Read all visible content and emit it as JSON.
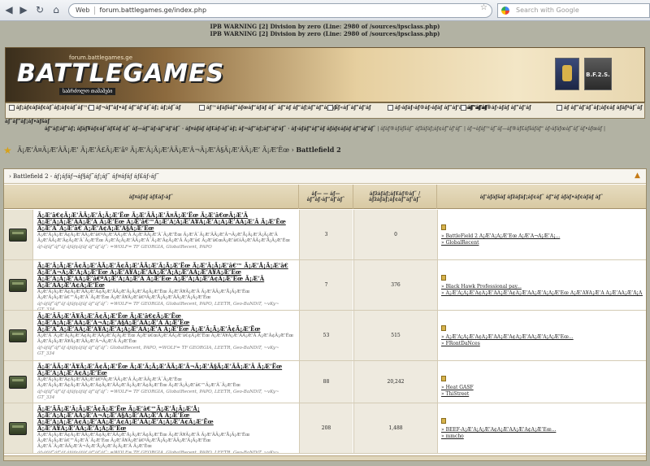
{
  "browser": {
    "address_prefix": "Web",
    "url": "forum.battlegames.ge/index.php",
    "search_placeholder": "Search with Google"
  },
  "warnings": [
    "IPB WARNING [2] Division by zero (Line: 2980 of /sources/ipsclass.php)",
    "IPB WARNING [2] Division by zero (Line: 2980 of /sources/ipsclass.php)"
  ],
  "banner": {
    "site_url": "forum.battlegames.ge",
    "logo_text": "BATTLEGAMES",
    "subtitle": "საბრძოლო თამაშები",
    "badge_text": "B.F.2.S."
  },
  "menu": {
    "items": [
      "áƒ¡áƒ¢áƒáƒ¢áƒ˜áƒ¡áƒ¢áƒ˜áƒ™áƒ",
      "áƒ¬áƒ”áƒ•áƒ áƒ”áƒ‘áƒ˜áƒ¡ áƒ¡áƒ˜áƒ",
      "áƒ™áƒáƒšáƒ”áƒœáƒ“áƒáƒ áƒ˜ áƒ“áƒ áƒ“áƒ¦áƒ”áƒ”áƒ‘áƒ˜",
      "áƒ«áƒ˜áƒ”áƒ‘áƒ",
      "áƒ›áƒáƒ›áƒ®áƒ›áƒáƒ áƒ”áƒ‘áƒšáƒ”áƒ‘áƒ˜",
      "áƒ“áƒáƒ®áƒ›áƒáƒ áƒ”áƒ‘áƒ",
      "áƒ áƒ”áƒ’áƒ˜áƒ¡áƒ¢áƒ áƒáƒªáƒ˜áƒ"
    ],
    "continuation": "áƒ¨áƒ”áƒ¡áƒ•áƒšáƒ"
  },
  "navlinks": {
    "main": "áƒ“áƒ¦áƒ”áƒ¡ áƒáƒ¥áƒ¢áƒ˜áƒ£áƒ áƒ˜ áƒ—áƒ”áƒ›áƒ”áƒ‘áƒ˜ · áƒ¤áƒáƒ áƒ£áƒ›áƒ˜áƒ¡ áƒ¬áƒ”áƒ¡áƒ”áƒ‘áƒ˜ · áƒ›áƒáƒ“áƒ”áƒ áƒáƒ¢áƒáƒ áƒ”áƒ‘áƒ˜",
    "small": "| áƒáƒ®áƒáƒšáƒ˜ áƒžáƒáƒ¡áƒ¢áƒ”áƒ‘áƒ˜ | áƒ¬áƒáƒ™áƒ˜áƒ—áƒ®áƒ£áƒšáƒáƒ“ áƒ›áƒáƒœáƒ˜áƒ¨áƒ•áƒœáƒ |"
  },
  "breadcrumb": {
    "trail": "Ã¡Æ’Â¤Ã¡Æ’ÂÃ¡Æ’ Ã¡Æ’Â£Ã¡Æ’âº Ã¡Æ’Â¡Ã¡Æ’ÂÃ¡Æ’Â¬Ã¡Æ’Â§Ã¡Æ’ÂÃ¡Æ’ Ã¡Æ’Ëœ",
    "current": "Battlefield 2"
  },
  "forum": {
    "category_title": "Battlefield 2 - áƒ¡áƒáƒ¬áƒ§áƒ˜áƒ¡áƒ˜ áƒ¤áƒáƒ áƒ£áƒ›áƒ˜",
    "columns": {
      "forum": "áƒ¤áƒáƒ áƒ£áƒ›áƒ˜",
      "topics": "áƒ— — áƒ—áƒ”áƒ›áƒ”áƒ‘áƒ˜",
      "replies": "áƒžáƒáƒ¡áƒ£áƒ®áƒ˜ / áƒžáƒáƒ¡áƒ¢áƒ”áƒ‘áƒ˜",
      "last": "áƒ‘áƒáƒšáƒ áƒžáƒáƒ¡áƒ¢áƒ˜ áƒ“áƒ áƒáƒ•áƒ¢áƒáƒ áƒ˜"
    },
    "rows": [
      {
        "title": "Ã¡Æ’â€¢Ã¡Æ’ÂÃ¡Æ’Â¡Ã¡Æ’Ëœ Ã¡Æ’ÂÃ¡Æ’Â¤Ã¡Æ’Ëœ Ã¡Æ’â€œÃ¡Æ’Â Ã¡Æ’Â¡Ã¡Æ’ÂÃ¡Æ’Â Ã¡Æ’Ëœ Ã¡Æ’â€™Ã¡Æ’Â¦Ã¡Æ’Â¥Ã¡Æ’Â¡Ã¡Æ’ÂÃ¡Æ’Â Ã¡Æ’Ëœ Ã¡Æ’Â¨Ã¡Æ’â€ Ã¡Æ’Â¢Ã¡Æ’Â§Ã¡Æ’Ëœ",
        "desc": "Ã¡Æ’Â¡Ã¡Æ’Â¢Ã¡Æ’ÂÃ¡Æ’â€ºÃ¡Æ’ÂÃ¡Æ’Â Ã¡Æ’ÂÃ¡Æ’Â¨Ã¡Æ’Ëœ Ã¡Æ’Â¨Ã¡Æ’ÂÃ¡Æ’Â¬Ã¡Æ’Å¡Ã¡Æ’Â¡Ã¡Æ’Â Ã¡Æ’ÂÃ¡Æ’Â¢Ã¡Æ’Â¨Ã¡Æ’Ëœ Ã¡Æ’Â¡Ã¡Æ’ÂÃ¡Æ’Â¨Ã¡Æ’Â¢Ã¡Æ’Â Ã¡Æ’â€ Ã¡Æ’â€œÃ¡Æ’â€šÃ¡Æ’ÂÃ¡Æ’Å¡Ã¡Æ’Ëœ",
        "mods": "áƒ›áƒáƒ“áƒ”áƒ áƒáƒ¢áƒáƒ áƒ”áƒ‘áƒ˜: =WOLF= TF GEORGIA, GlobalRecent, PAPO",
        "topics": "3",
        "replies": "0",
        "last_lines": [
          "» BattleField 2 Ã¡Æ’Â¡Ã¡Æ’Ëœ Ã¡Æ’Â¬Ã¡Æ’Â¡...",
          "» GlobalRecent"
        ]
      },
      {
        "title": "Ã¡Æ’Â¡Ã¡Æ’Â¢Ã¡Æ’ÂÃ¡Æ’Â¢Ã¡Æ’ÂÃ¡Æ’Â¡Ã¡Æ’Ëœ Ã¡Æ’Â¡Ã¡Æ’â€™ Ã¡Æ’Å¡Ã¡Æ’â€ Ã¡Æ’Â¬Ã¡Æ’Â¡Ã¡Æ’Ëœ Ã¡Æ’Â¥Ã¡Æ’ÂÃ¡Æ’Å¡Ã¡Æ’ÂÃ¡Æ’Â¥Ã¡Æ’Ëœ Ã¡Æ’Â¡Ã¡Æ’ÂÃ¡Æ’â€ºÃ¡Æ’Â¡Ã¡Æ’Â Ã¡Æ’Ëœ Ã¡Æ’Â¡Ã¡Æ’Â¢Ã¡Æ’Ëœ Ã¡Æ’Â Ã¡Æ’ÂÃ¡Æ’Â¢Ã¡Æ’Ëœ",
        "desc": "Ã¡Æ’Â¡Ã¡Æ’Â¢Ã¡Æ’ÂÃ¡Æ’Â¢Ã¡Æ’ÂÃ¡Æ’Â¡Ã¡Æ’Â¢Ã¡Æ’Ëœ Ã¡Æ’Â¥Ã¡Æ’Â Ã¡Æ’ÂÃ¡Æ’Å¡Ã¡Æ’Ëœ Ã¡Æ’Â¡Ã¡Æ’â€™Ã¡Æ’Â¨Ã¡Æ’Ëœ Ã¡Æ’Â¥Ã¡Æ’â€ºÃ¡Æ’Å¡Ã¡Æ’ÂÃ¡Æ’Â¡Ã¡Æ’Ëœ",
        "mods": "áƒ›áƒáƒ“áƒ”áƒ áƒáƒ¢áƒáƒ áƒ”áƒ‘áƒ˜: =WOLF= TF GEORGIA, GlobalRecent, PAPO, LEETR, Geo-BaNDiT, ~vKy~ GT_334",
        "topics": "7",
        "replies": "376",
        "last_lines": [
          "» Black Hawk Professional pay...",
          "» Ã¡Æ’Â¡Ã¡Æ’Â¢Ã¡Æ’ÂÃ¡Æ’Â¢Ã¡Æ’ÂÃ¡Æ’Â¡Ã¡Æ’Ëœ Ã¡Æ’Â¥Ã¡Æ’Â Ã¡Æ’ÂÃ¡Æ’Å¡Ã¡Æ’Ëœ"
        ]
      },
      {
        "title": "Ã¡Æ’ÂÃ¡Æ’Â¥Ã¡Æ’Â¢Ã¡Æ’Ëœ Ã¡Æ’â€¢Ã¡Æ’Ëœ Ã¡Æ’Â¡Ã¡Æ’ÂÃ¡Æ’Â¬Ã¡Æ’Â§Ã¡Æ’ÂÃ¡Æ’Â Ã¡Æ’Ëœ Ã¡Æ’Â¨Ã¡Æ’ÂÃ¡Æ’Â¥Ã¡Æ’Â¡Ã¡Æ’ÂÃ¡Æ’Â Ã¡Æ’Ëœ Ã¡Æ’Â¡Ã¡Æ’Â¢Ã¡Æ’Ëœ",
        "desc": "Ã¡Æ’Â¨Ã¡Æ’Â¡Ã¡Æ’Â¢Ã¡Æ’ÂÃ¡Æ’Â¡Ã¡Æ’Ëœ Ã¡Æ’â€œÃ¡Æ’ÂÃ¡Æ’â€¢Ã¡Æ’Ëœ Ã¡Æ’Â¥Ã¡Æ’ÂÃ¡Æ’Â Ã¡Æ’Â¢Ã¡Æ’Ëœ Ã¡Æ’Â¡Ã¡Æ’Â¥Ã¡Æ’ÂÃ¡Æ’Â¬Ã¡Æ’Â Ã¡Æ’Ëœ",
        "mods": "áƒ›áƒáƒ“áƒ”áƒ áƒáƒ¢áƒáƒ áƒ”áƒ‘áƒ˜: GlobalRecent, PAPO, =WOLF= TF GEORGIA, LEETR, Geo-BaNDiT, ~vKy~ GT_334",
        "topics": "53",
        "replies": "515",
        "last_lines": [
          "» Ã¡Æ’Â¡Ã¡Æ’Â¢Ã¡Æ’ÂÃ¡Æ’Â¢Ã¡Æ’ÂÃ¡Æ’Â¡Ã¡Æ’Ëœ...",
          "» FRontDaNces"
        ]
      },
      {
        "title": "Ã¡Æ’ÂÃ¡Æ’Â¥Ã¡Æ’Â¢Ã¡Æ’Ëœ Ã¡Æ’Â¡Ã¡Æ’ÂÃ¡Æ’Â¬Ã¡Æ’Â§Ã¡Æ’ÂÃ¡Æ’Â Ã¡Æ’Ëœ Ã¡Æ’Â¡Ã¡Æ’Â¢Ã¡Æ’Ëœ",
        "desc": "Ã¡Æ’Â¡Ã¡Æ’Â¢Ã¡Æ’ÂÃ¡Æ’â€ºÃ¡Æ’ÂÃ¡Æ’Â Ã¡Æ’ÂÃ¡Æ’Â¨Ã¡Æ’Ëœ Ã¡Æ’Â¡Ã¡Æ’Â¢Ã¡Æ’ÂÃ¡Æ’Â¢Ã¡Æ’ÂÃ¡Æ’Â¡Ã¡Æ’Â¢Ã¡Æ’Ëœ Ã¡Æ’Â¡Ã¡Æ’â€™Ã¡Æ’Â¨Ã¡Æ’Ëœ",
        "mods": "áƒ›áƒáƒ“áƒ”áƒ áƒáƒ¢áƒáƒ áƒ”áƒ‘áƒ˜: =WOLF= TF GEORGIA, GlobalRecent, PAPO, LEETR, Geo-BaNDiT, ~vKy~ GT_334",
        "topics": "88",
        "replies": "20,242",
        "last_lines": [
          "» Heat GASF",
          "» ThiStreet"
        ]
      },
      {
        "title": "Ã¡Æ’ÂÃ¡Æ’Â¡Ã¡Æ’Â¢Ã¡Æ’Ëœ Ã¡Æ’â€™Ã¡Æ’Å¡Ã¡Æ’Å¡ Ã¡Æ’Â¡Ã¡Æ’ÂÃ¡Æ’Â¬Ã¡Æ’Â§Ã¡Æ’ÂÃ¡Æ’Â Ã¡Æ’Ëœ Ã¡Æ’Â¡Ã¡Æ’Â¢Ã¡Æ’ÂÃ¡Æ’Â¢Ã¡Æ’ÂÃ¡Æ’Â¡Ã¡Æ’Â¢Ã¡Æ’Ëœ Ã¡Æ’Â¥Ã¡Æ’ÂÃ¡Æ’Å¡Ã¡Æ’Ëœ",
        "desc": "Ã¡Æ’Â¡Ã¡Æ’Â¢Ã¡Æ’ÂÃ¡Æ’Â¢Ã¡Æ’ÂÃ¡Æ’Â¡Ã¡Æ’Â¢Ã¡Æ’Ëœ Ã¡Æ’Â¥Ã¡Æ’Â Ã¡Æ’ÂÃ¡Æ’Å¡Ã¡Æ’Ëœ Ã¡Æ’Â¡Ã¡Æ’â€™Ã¡Æ’Â¨Ã¡Æ’Ëœ Ã¡Æ’Â¥Ã¡Æ’â€ºÃ¡Æ’Å¡Ã¡Æ’ÂÃ¡Æ’Â¡Ã¡Æ’Ëœ Ã¡Æ’Â¨Ã¡Æ’ÂÃ¡Æ’Â¬Ã¡Æ’Å¡Ã¡Æ’Â¡Ã¡Æ’Â Ã¡Æ’Ëœ",
        "mods": "áƒ›áƒáƒ“áƒ”áƒ áƒáƒ¢áƒáƒ áƒ”áƒ‘áƒ˜: =WOLF= TF GEORGIA, GlobalRecent, PAPO, LEETR, Geo-BaNDiT, ~vKy~ GT_334",
        "topics": "208",
        "replies": "1,488",
        "last_lines": [
          "» BEEF-Ã¡Æ’Â¡Ã¡Æ’Â¢Ã¡Æ’ÂÃ¡Æ’Â¢Ã¡Æ’Ëœ...",
          "» mmcho"
        ]
      }
    ]
  }
}
